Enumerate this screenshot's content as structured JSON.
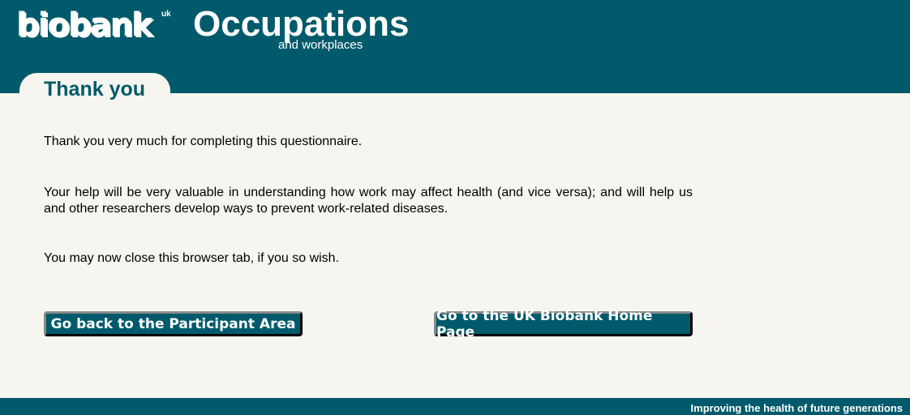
{
  "header": {
    "logo_text": "biobank",
    "logo_superscript": "uk",
    "title": "Occupations",
    "subtitle": "and workplaces"
  },
  "page": {
    "tab_label": "Thank you",
    "paragraphs": [
      "Thank you very much for completing this questionnaire.",
      "Your help will be very valuable in understanding how work may affect health (and vice versa); and will help us and other researchers develop ways to prevent work-related diseases.",
      "You may now close this browser tab, if you so wish."
    ]
  },
  "buttons": {
    "participant_area": "Go back to the Participant Area",
    "home_page": "Go to the UK Biobank Home Page"
  },
  "footer": {
    "tagline": "Improving the health of future generations"
  },
  "colors": {
    "brand_teal": "#005a6b",
    "page_background": "#f6f5ef"
  }
}
